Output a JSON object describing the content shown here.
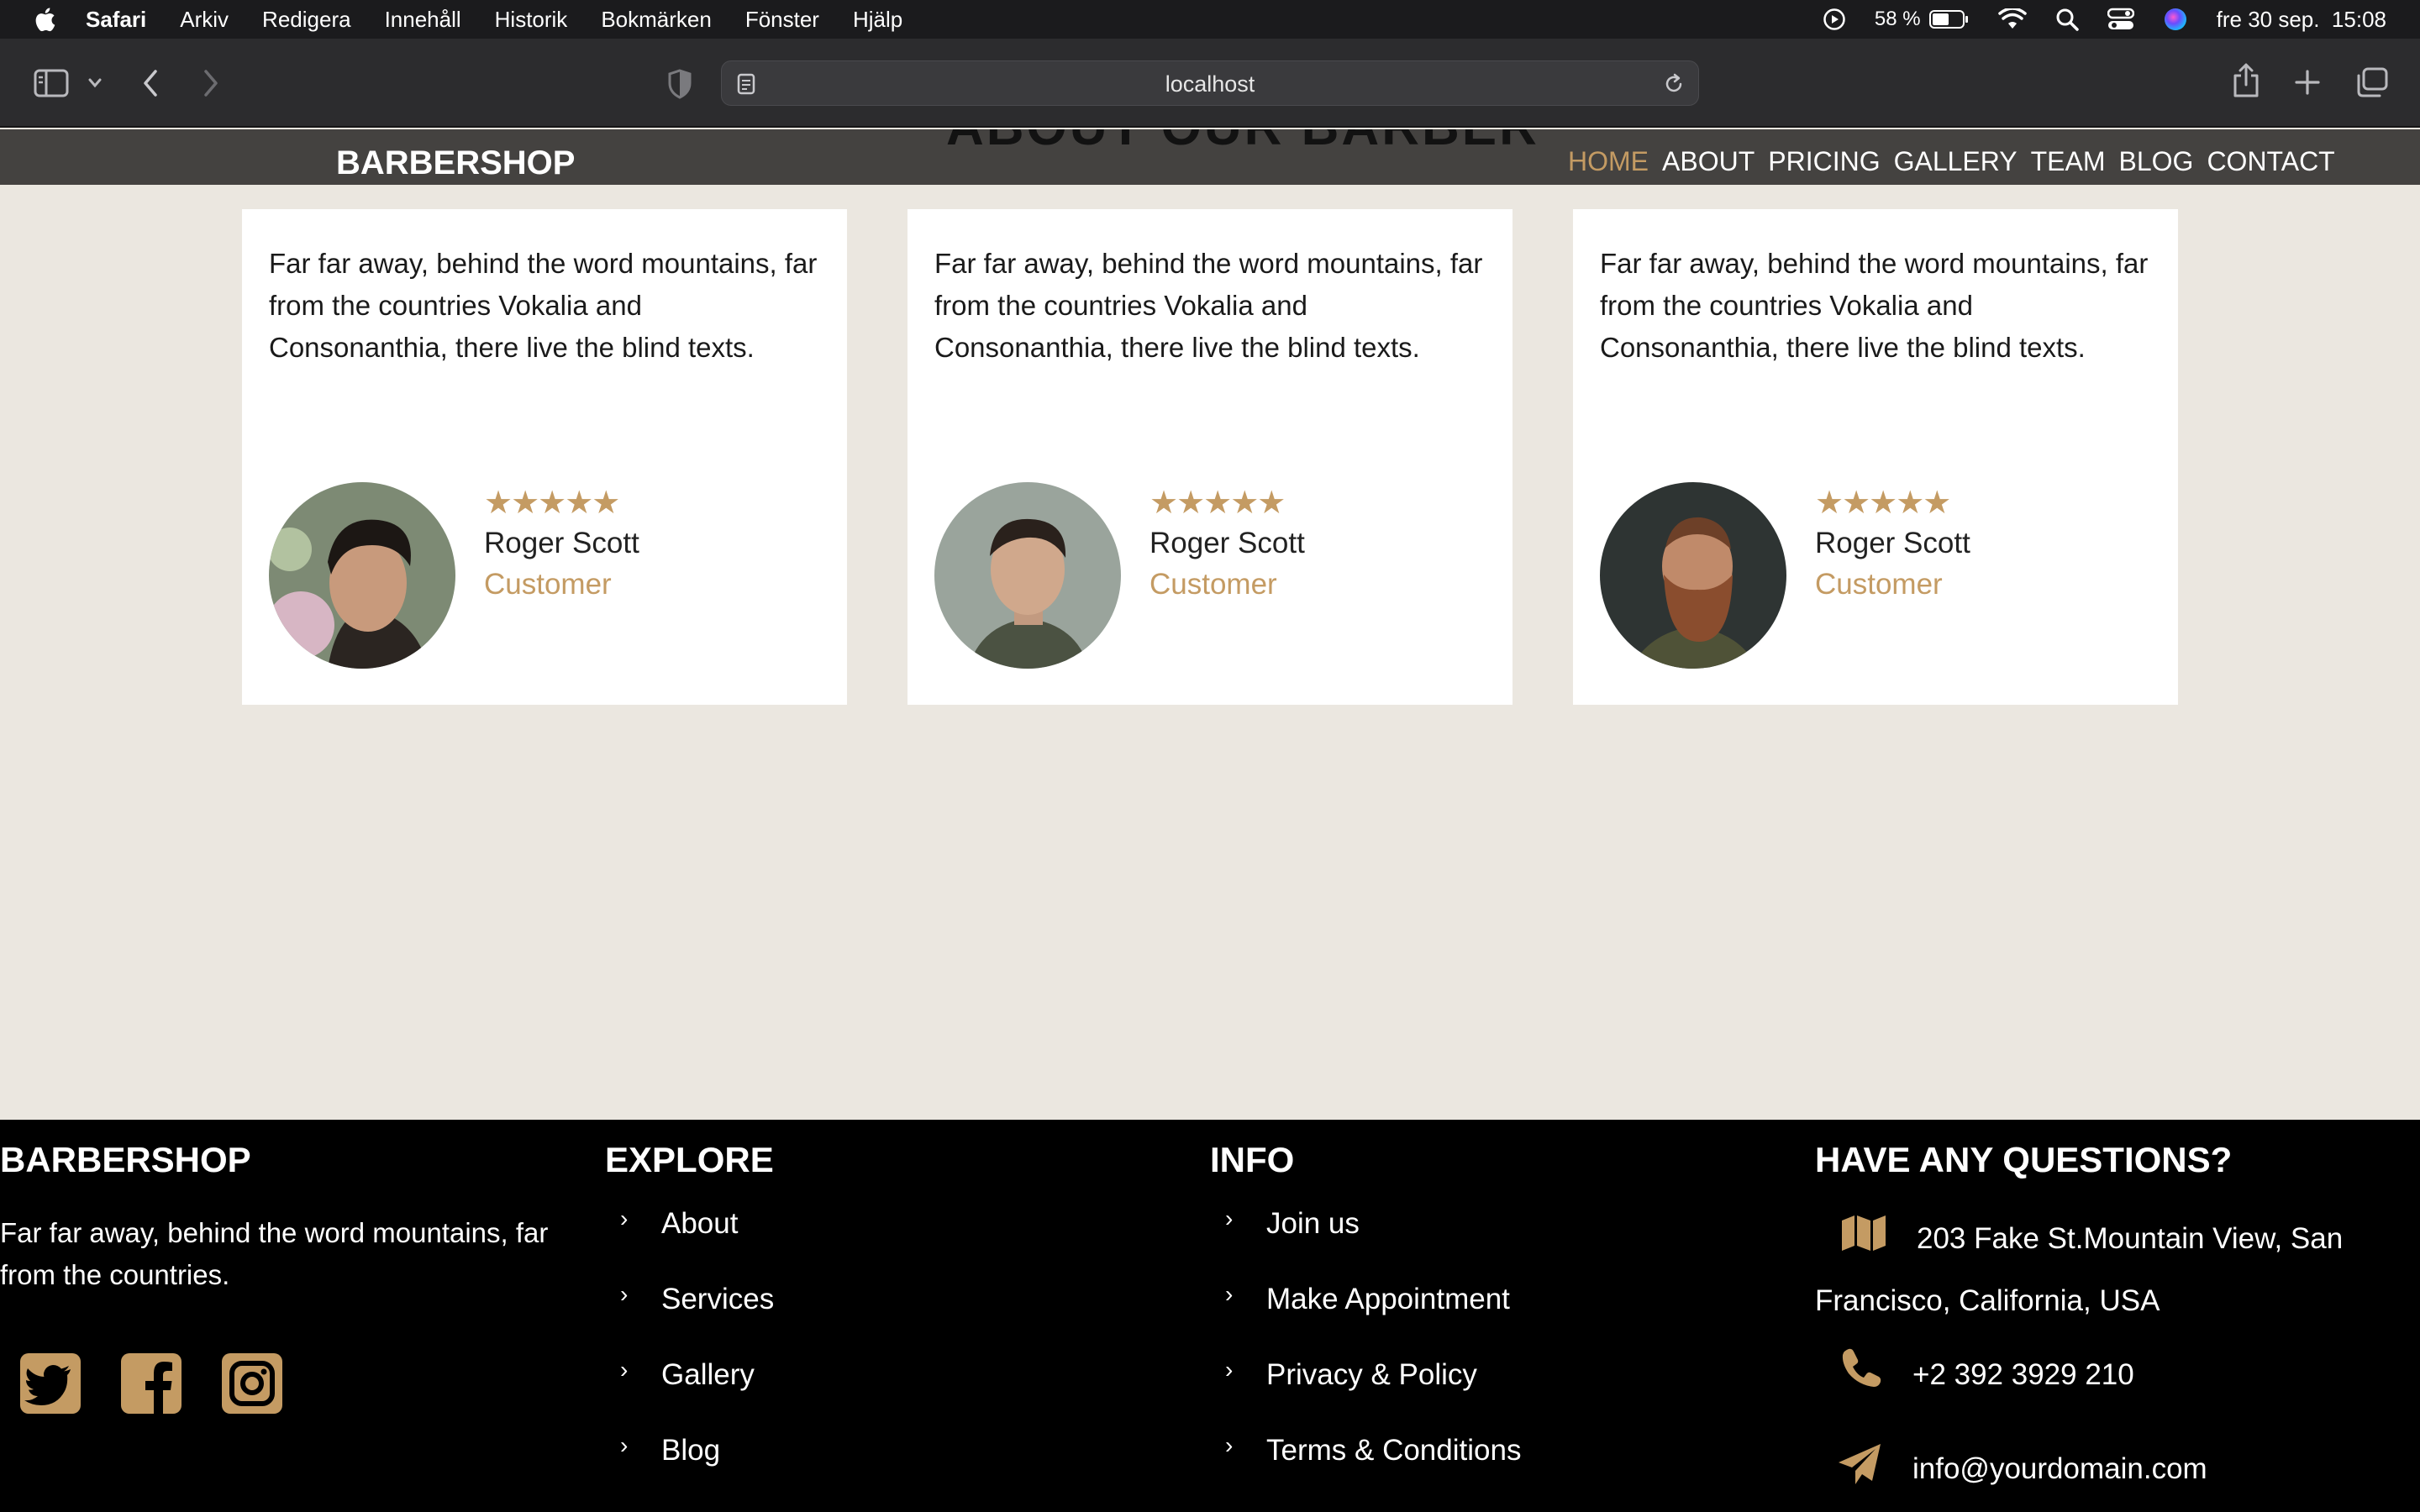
{
  "menubar": {
    "app_name": "Safari",
    "items": [
      "Arkiv",
      "Redigera",
      "Innehåll",
      "Historik",
      "Bokmärken",
      "Fönster",
      "Hjälp"
    ],
    "battery": "58 %",
    "datetime": "fre 30 sep.  15:08"
  },
  "browser": {
    "url": "localhost"
  },
  "site": {
    "brand": "BARBERSHOP",
    "ghost_title": "ABOUT OUR BARBER",
    "nav": [
      "HOME",
      "ABOUT",
      "PRICING",
      "GALLERY",
      "TEAM",
      "BLOG",
      "CONTACT"
    ],
    "active_nav": "HOME",
    "accent_color": "#c49b63"
  },
  "testimonials": [
    {
      "quote": "Far far away, behind the word mountains, far from the countries Vokalia and Consonanthia, there live the blind texts.",
      "stars": "★★★★★",
      "rating": 5,
      "name": "Roger Scott",
      "role": "Customer"
    },
    {
      "quote": "Far far away, behind the word mountains, far from the countries Vokalia and Consonanthia, there live the blind texts.",
      "stars": "★★★★★",
      "rating": 5,
      "name": "Roger Scott",
      "role": "Customer"
    },
    {
      "quote": "Far far away, behind the word mountains, far from the countries Vokalia and Consonanthia, there live the blind texts.",
      "stars": "★★★★★",
      "rating": 5,
      "name": "Roger Scott",
      "role": "Customer"
    }
  ],
  "footer": {
    "about": {
      "heading": "BARBERSHOP",
      "text": "Far far away, behind the word mountains, far from the countries.",
      "social": [
        "twitter-icon",
        "facebook-icon",
        "instagram-icon"
      ]
    },
    "explore": {
      "heading": "EXPLORE",
      "links": [
        "About",
        "Services",
        "Gallery",
        "Blog"
      ]
    },
    "info": {
      "heading": "INFO",
      "links": [
        "Join us",
        "Make Appointment",
        "Privacy & Policy",
        "Terms & Conditions"
      ]
    },
    "questions": {
      "heading": "HAVE ANY QUESTIONS?",
      "address_line1": "203 Fake St.Mountain View, San",
      "address_line2": "Francisco, California, USA",
      "phone": "+2 392 3929 210",
      "email": "info@yourdomain.com"
    }
  }
}
